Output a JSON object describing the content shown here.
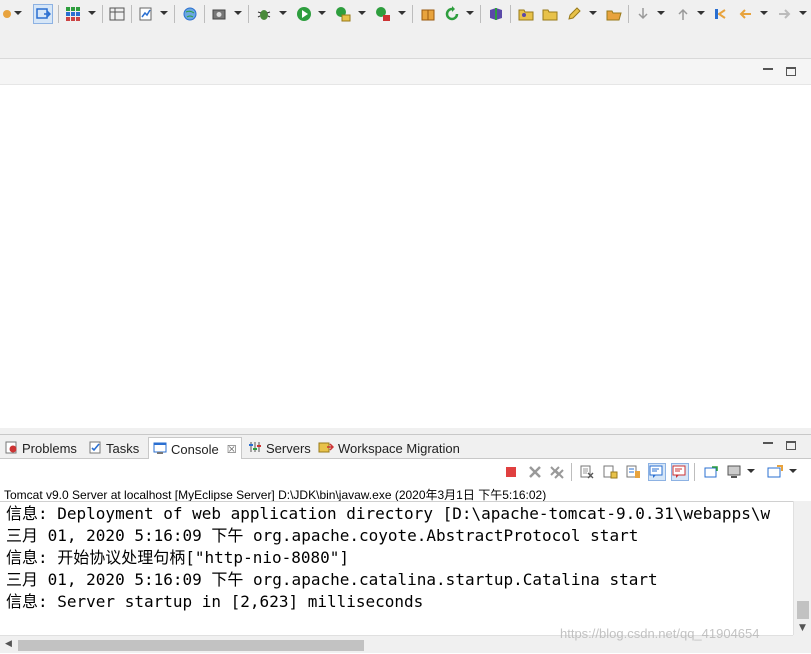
{
  "tabs": [
    {
      "label": "Problems",
      "icon": "problems-icon"
    },
    {
      "label": "Tasks",
      "icon": "tasks-icon"
    },
    {
      "label": "Console",
      "icon": "console-icon",
      "active": true
    },
    {
      "label": "Servers",
      "icon": "servers-icon"
    },
    {
      "label": "Workspace Migration",
      "icon": "workspace-migration-icon"
    }
  ],
  "console": {
    "process_label": "Tomcat v9.0 Server at localhost [MyEclipse Server] D:\\JDK\\bin\\javaw.exe (2020年3月1日 下午5:16:02)",
    "lines": [
      "信息: Deployment of web application directory [D:\\apache-tomcat-9.0.31\\webapps\\w",
      "三月 01, 2020 5:16:09 下午 org.apache.coyote.AbstractProtocol start",
      "信息: 开始协议处理句柄[\"http-nio-8080\"]",
      "三月 01, 2020 5:16:09 下午 org.apache.catalina.startup.Catalina start",
      "信息: Server startup in [2,623] milliseconds"
    ]
  },
  "watermark": "https://blog.csdn.net/qq_41904654",
  "colors": {
    "terminate": "#e04040",
    "accent_blue": "#2a6fd1",
    "green": "#2e9e3e"
  }
}
